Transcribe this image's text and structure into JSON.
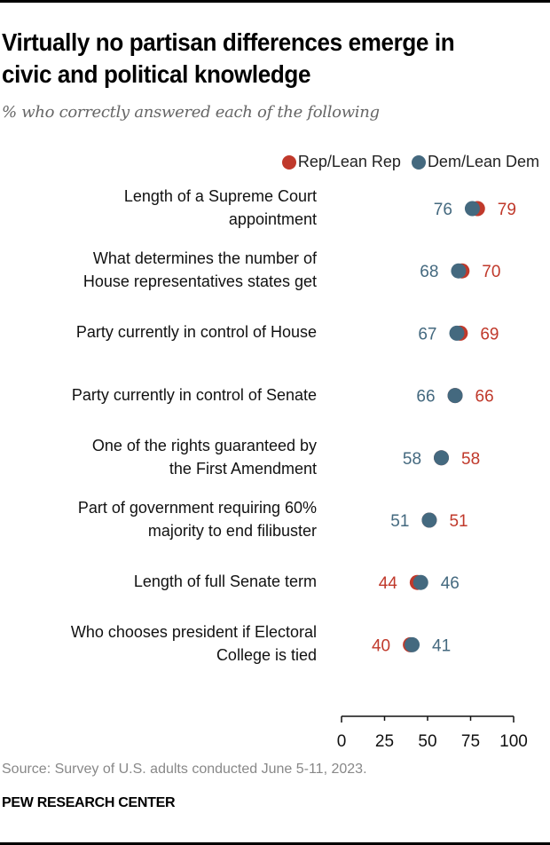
{
  "header": {
    "title": "Virtually no partisan differences emerge in civic and political knowledge",
    "subtitle": "% who correctly answered each of the following"
  },
  "legend": [
    {
      "label": "Rep/Lean Rep",
      "color": "#c0392b"
    },
    {
      "label": "Dem/Lean Dem",
      "color": "#44697f"
    }
  ],
  "footer": {
    "source": "Source: Survey of U.S. adults conducted June 5-11, 2023.",
    "brand": "PEW RESEARCH CENTER"
  },
  "chart_data": {
    "type": "scatter",
    "subtype": "dot-plot",
    "title": "Virtually no partisan differences emerge in civic and political knowledge",
    "subtitle": "% who correctly answered each of the following",
    "xlabel": "",
    "ylabel": "",
    "xlim": [
      0,
      100
    ],
    "xticks": [
      0,
      25,
      50,
      75,
      100
    ],
    "grid": false,
    "legend_position": "top-right",
    "categories": [
      "Length of a Supreme Court appointment",
      "What determines the number of House representatives states get",
      "Party currently in control of House",
      "Party currently in control of Senate",
      "One of the rights guaranteed by the First Amendment",
      "Part of government requiring 60% majority to end filibuster",
      "Length of full Senate term",
      "Who chooses president if Electoral College is tied"
    ],
    "category_lines": [
      [
        "Length of a Supreme Court",
        "appointment"
      ],
      [
        "What determines the number of",
        "House representatives states get"
      ],
      [
        "Party currently in control of House"
      ],
      [
        "Party currently in control of Senate"
      ],
      [
        "One of the rights guaranteed by",
        "the First Amendment"
      ],
      [
        "Part of government requiring 60%",
        "majority to end filibuster"
      ],
      [
        "Length of full Senate term"
      ],
      [
        "Who chooses president if Electoral",
        "College is tied"
      ]
    ],
    "series": [
      {
        "name": "Rep/Lean Rep",
        "color": "#c0392b",
        "values": [
          79,
          70,
          69,
          66,
          58,
          51,
          44,
          40
        ]
      },
      {
        "name": "Dem/Lean Dem",
        "color": "#44697f",
        "values": [
          76,
          68,
          67,
          66,
          58,
          51,
          46,
          41
        ]
      }
    ]
  }
}
